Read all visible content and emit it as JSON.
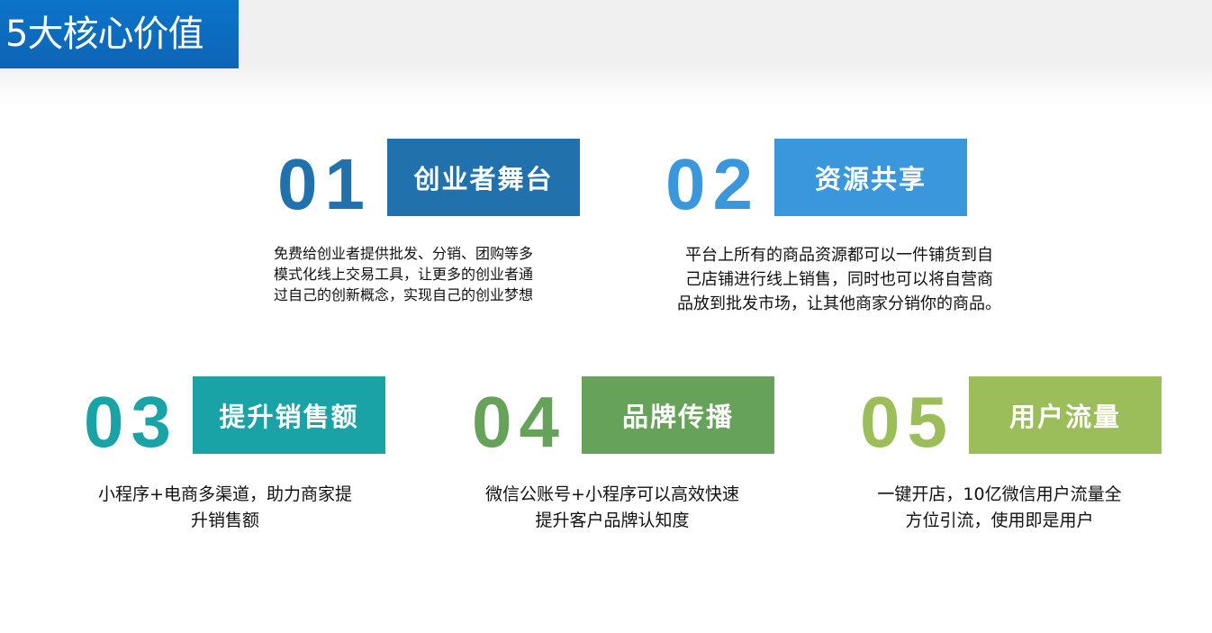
{
  "title": "5大核心价值",
  "colors": {
    "title_bg": "#0b6ec4",
    "v1": "#2171ad",
    "v2": "#3b97dc",
    "v3": "#1aa3a6",
    "v4": "#67a25b",
    "v5": "#9cbe5a"
  },
  "values": [
    {
      "num": "01",
      "label": "创业者舞台",
      "desc": [
        "免费给创业者提供批发、分销、团购等多",
        "模式化线上交易工具，让更多的创业者通",
        "过自己的创新概念，实现自己的创业梦想"
      ]
    },
    {
      "num": "02",
      "label": "资源共享",
      "desc": [
        "平台上所有的商品资源都可以一件铺货到自",
        "己店铺进行线上销售，同时也可以将自营商",
        "品放到批发市场，让其他商家分销你的商品。"
      ]
    },
    {
      "num": "03",
      "label": "提升销售额",
      "desc": [
        "小程序+电商多渠道，助力商家提",
        "升销售额"
      ]
    },
    {
      "num": "04",
      "label": "品牌传播",
      "desc": [
        "微信公账号+小程序可以高效快速",
        "提升客户品牌认知度"
      ]
    },
    {
      "num": "05",
      "label": "用户流量",
      "desc": [
        "一键开店，10亿微信用户流量全",
        "方位引流，使用即是用户"
      ]
    }
  ]
}
